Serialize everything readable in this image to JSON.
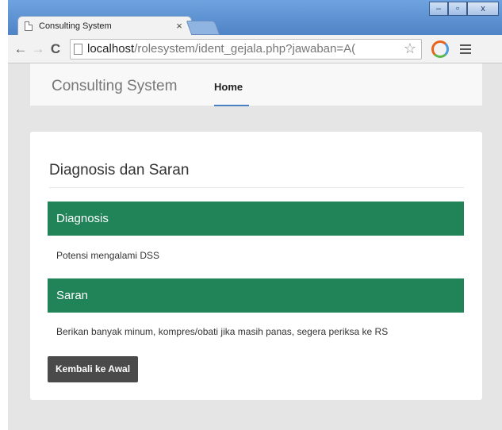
{
  "browser": {
    "tab_title": "Consulting System",
    "tab_close": "×",
    "url_host": "localhost",
    "url_path": "/rolesystem/ident_gejala.php?jawaban=A(",
    "window_controls": [
      "–",
      "▫",
      "x"
    ]
  },
  "navbar": {
    "brand": "Consulting System",
    "home_link": "Home"
  },
  "panel": {
    "title": "Diagnosis dan Saran",
    "diagnosis_heading": "Diagnosis",
    "diagnosis_text": "Potensi mengalami DSS",
    "saran_heading": "Saran",
    "saran_text": "Berikan banyak minum, kompres/obati jika masih panas, segera periksa ke RS",
    "back_button": "Kembali ke Awal"
  },
  "colors": {
    "section_bar": "#218358",
    "button": "#4a4a4a",
    "nav_active_underline": "#4a7fc2"
  }
}
